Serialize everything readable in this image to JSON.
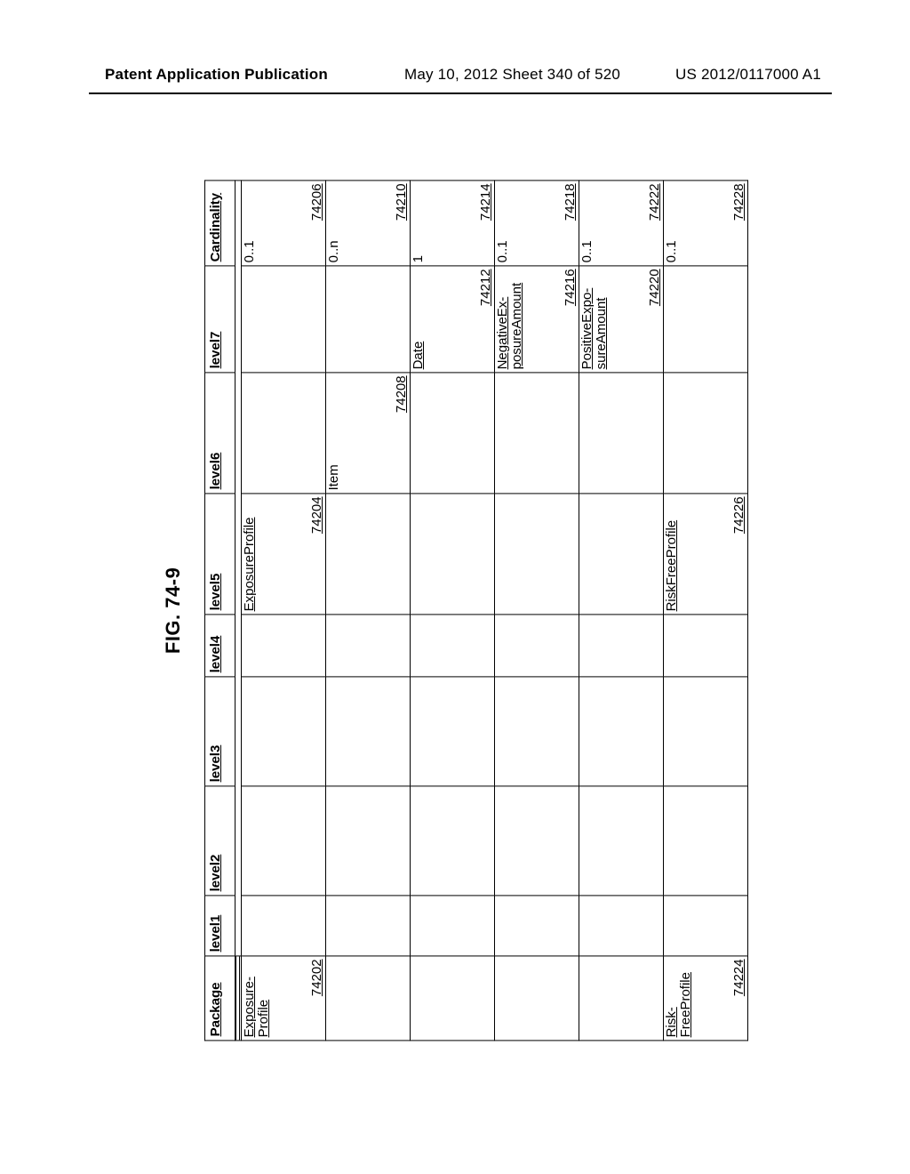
{
  "header": {
    "left": "Patent Application Publication",
    "mid": "May 10, 2012  Sheet 340 of 520",
    "right": "US 2012/0117000 A1"
  },
  "figure_title": "FIG. 74-9",
  "columns": [
    "Package",
    "level1",
    "level2",
    "level3",
    "level4",
    "level5",
    "level6",
    "level7",
    "Cardinality"
  ],
  "rows": [
    {
      "package": {
        "text": "Exposure-Profile",
        "ref": "74202"
      },
      "level5": {
        "text": "ExposureProfile",
        "ref": "74204"
      },
      "cardinality": {
        "text": "0..1",
        "ref": "74206"
      }
    },
    {
      "level6": {
        "text": "Item",
        "ref": "74208"
      },
      "cardinality": {
        "text": "0..n",
        "ref": "74210"
      }
    },
    {
      "level7": {
        "text": "Date",
        "ref": "74212"
      },
      "cardinality": {
        "text": "1",
        "ref": "74214"
      }
    },
    {
      "level7": {
        "text": "NegativeEx-posureAmount",
        "ref": "74216"
      },
      "cardinality": {
        "text": "0..1",
        "ref": "74218"
      }
    },
    {
      "level7": {
        "text": "PositiveExpo-sureAmount",
        "ref": "74220"
      },
      "cardinality": {
        "text": "0..1",
        "ref": "74222"
      }
    },
    {
      "package": {
        "text": "Risk-FreeProfile",
        "ref": "74224"
      },
      "level5": {
        "text": "RiskFreeProfile",
        "ref": "74226"
      },
      "cardinality": {
        "text": "0..1",
        "ref": "74228"
      }
    }
  ]
}
